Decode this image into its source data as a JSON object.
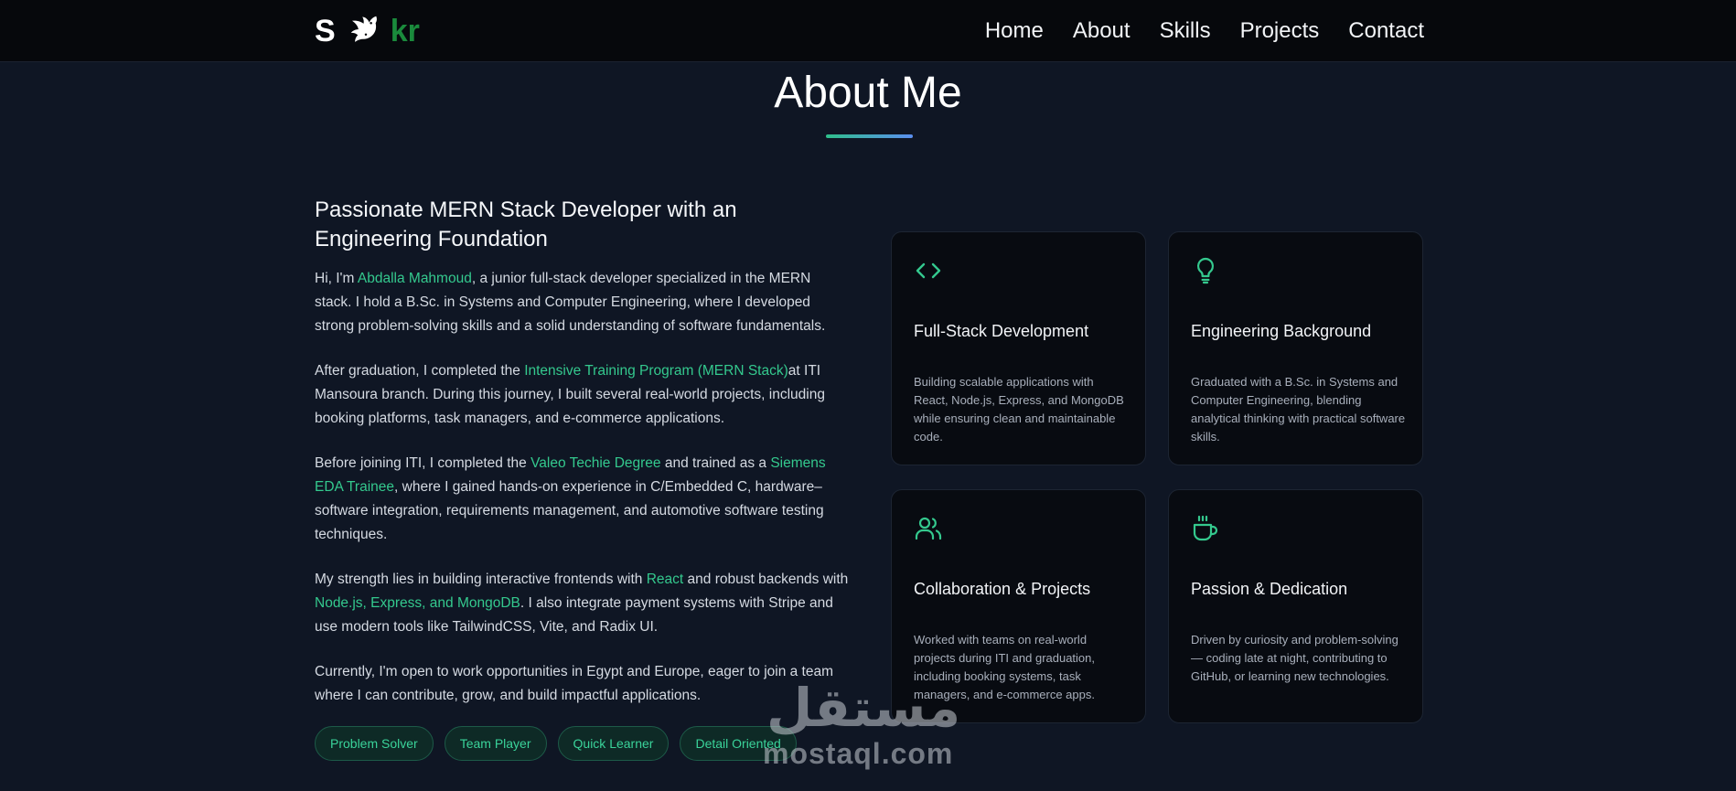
{
  "nav": {
    "logo_left": "S",
    "logo_right": "kr",
    "links": [
      "Home",
      "About",
      "Skills",
      "Projects",
      "Contact"
    ]
  },
  "page": {
    "title": "About Me"
  },
  "about": {
    "heading": "Passionate MERN Stack Developer with an Engineering Foundation",
    "p1": {
      "a": "Hi, I'm ",
      "b": "Abdalla Mahmoud",
      "c": ", a junior full-stack developer specialized in the MERN stack. I hold a B.Sc. in Systems and Computer Engineering, where I developed strong problem-solving skills and a solid understanding of software fundamentals."
    },
    "p2": {
      "a": "After graduation, I completed the ",
      "b": "Intensive Training Program (MERN Stack)",
      "c": "at ITI Mansoura branch. During this journey, I built several real-world projects, including booking platforms, task managers, and e-commerce applications."
    },
    "p3": {
      "a": "Before joining ITI, I completed the ",
      "b": "Valeo Techie Degree",
      "c": " and trained as a ",
      "d": "Siemens EDA Trainee",
      "e": ", where I gained hands-on experience in C/Embedded C, hardware–software integration, requirements management, and automotive software testing techniques."
    },
    "p4": {
      "a": "My strength lies in building interactive frontends with ",
      "b": "React",
      "c": " and robust backends with ",
      "d": "Node.js, Express, and MongoDB",
      "e": ". I also integrate payment systems with Stripe and use modern tools like TailwindCSS, Vite, and Radix UI."
    },
    "p5": "Currently, I'm open to work opportunities in Egypt and Europe, eager to join a team where I can contribute, grow, and build impactful applications.",
    "tags": [
      "Problem Solver",
      "Team Player",
      "Quick Learner",
      "Detail Oriented"
    ]
  },
  "cards": [
    {
      "icon": "code-icon",
      "title": "Full-Stack Development",
      "text": "Building scalable applications with React, Node.js, Express, and MongoDB while ensuring clean and maintainable code."
    },
    {
      "icon": "lightbulb-icon",
      "title": "Engineering Background",
      "text": "Graduated with a B.Sc. in Systems and Computer Engineering, blending analytical thinking with practical software skills."
    },
    {
      "icon": "users-icon",
      "title": "Collaboration & Projects",
      "text": "Worked with teams on real-world projects during ITI and graduation, including booking systems, task managers, and e-commerce apps."
    },
    {
      "icon": "coffee-icon",
      "title": "Passion & Dedication",
      "text": "Driven by curiosity and problem-solving — coding late at night, contributing to GitHub, or learning new technologies."
    }
  ],
  "watermark": {
    "arabic": "مستقل",
    "latin": "mostaql.com"
  },
  "colors": {
    "accent": "#34c98e",
    "background": "#0f1624",
    "navbar": "#06080c",
    "card": "#080b11",
    "logo_green": "#1a8a3c"
  }
}
